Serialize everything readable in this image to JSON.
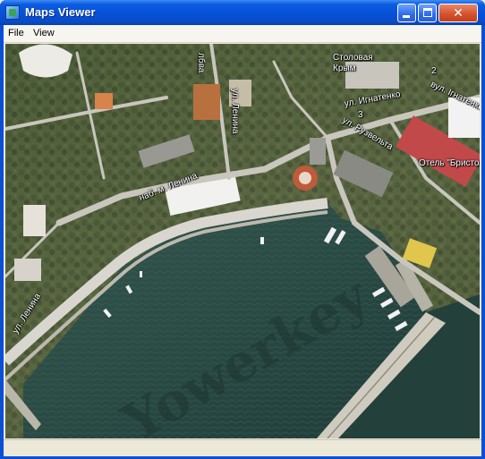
{
  "window": {
    "title": "Maps Viewer"
  },
  "title_buttons": {
    "minimize": "minimize",
    "maximize": "maximize",
    "close": "close"
  },
  "menu": {
    "file": "File",
    "view": "View"
  },
  "map": {
    "labels": {
      "lenina_street": "ул. Ленина",
      "stolovaya": "Столовая",
      "krym": "Крым",
      "ignatenko_left": "ул. Игнатенко",
      "ignatenko_num": "3",
      "ignatenko_right": "вул. Ігнатенко",
      "num_2": "2",
      "ruzvelta": "ул. Рузвельта",
      "hotel_bristol": "Отель \"Бристоль\"",
      "naberezhnaya": "наб. м. Ленина",
      "lenina_vertical": "лбва",
      "lenina_pier": "ул. Ленина"
    },
    "watermark": "Yowerkey"
  },
  "colors": {
    "titlebar": "#0651d8",
    "sea": "#2a4a44",
    "land": "#5c6b48",
    "roads": "#c8c6bf"
  }
}
